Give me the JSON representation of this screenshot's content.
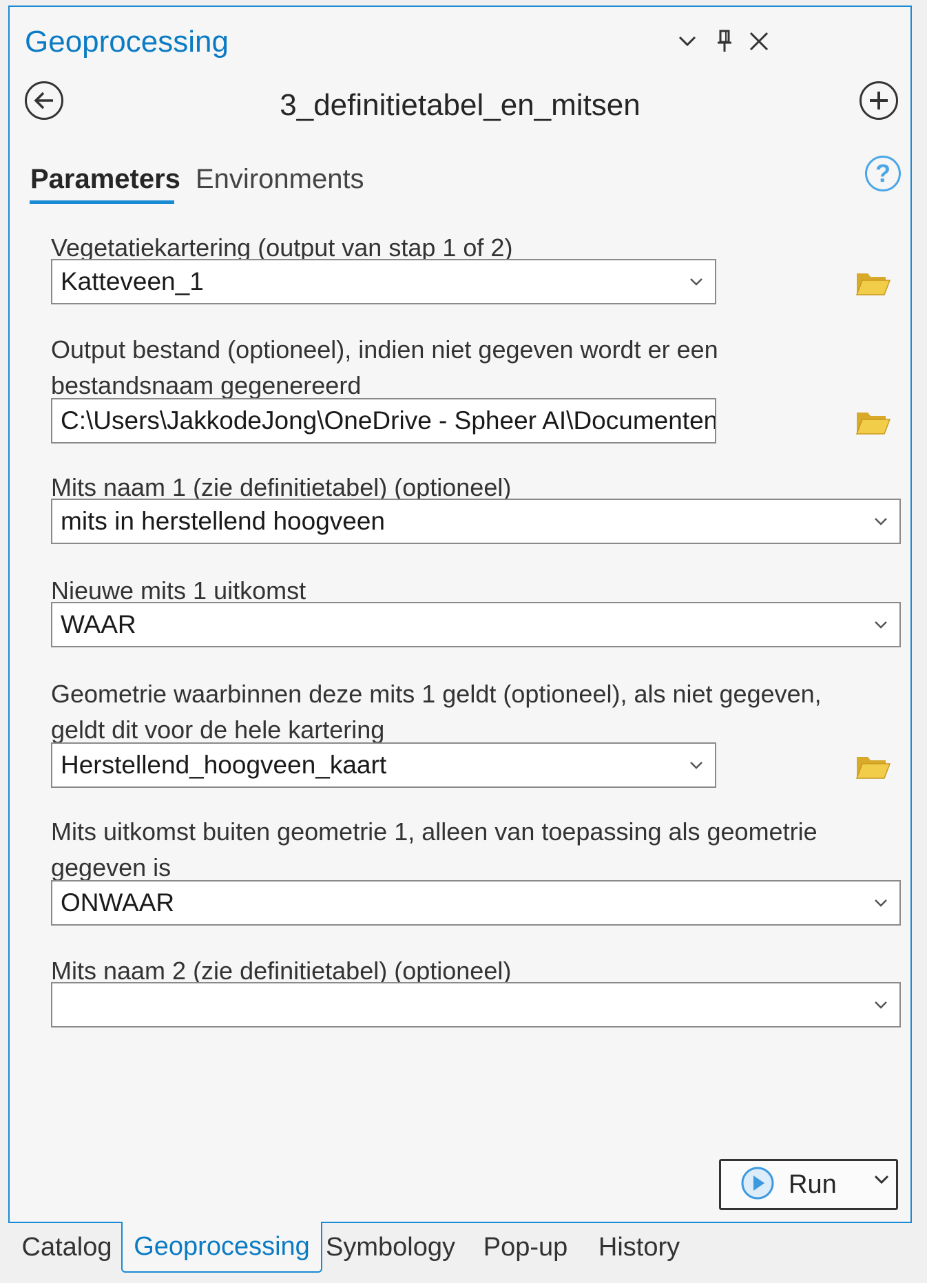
{
  "pane": {
    "title": "Geoprocessing",
    "tool_name": "3_definitietabel_en_mitsen",
    "controls": {
      "collapse_icon": "chevron-down-icon",
      "pin_icon": "pin-icon",
      "close_icon": "close-icon"
    }
  },
  "tabs": {
    "parameters": "Parameters",
    "environments": "Environments",
    "help_icon": "help-icon",
    "help_glyph": "?"
  },
  "params": [
    {
      "label": "Vegetatiekartering (output van stap 1 of 2)",
      "value": "Katteveen_1"
    },
    {
      "label": "Output bestand (optioneel), indien niet gegeven wordt er een bestandsnaam gegenereerd",
      "value": "C:\\Users\\JakkodeJong\\OneDrive - Spheer AI\\Documenten\\ArcGIS\\Pro"
    },
    {
      "label": "Mits naam 1 (zie definitietabel) (optioneel)",
      "value": "mits in herstellend hoogveen"
    },
    {
      "label": "Nieuwe mits 1 uitkomst",
      "value": "WAAR"
    },
    {
      "label": "Geometrie waarbinnen deze mits 1 geldt (optioneel), als niet gegeven, geldt dit voor de hele kartering",
      "value": "Herstellend_hoogveen_kaart"
    },
    {
      "label": "Mits uitkomst buiten geometrie 1, alleen van toepassing als geometrie gegeven is",
      "value": "ONWAAR"
    },
    {
      "label": "Mits naam 2 (zie definitietabel) (optioneel)",
      "value": ""
    }
  ],
  "run": {
    "label": "Run"
  },
  "bottom_tabs": [
    "Catalog",
    "Geoprocessing",
    "Symbology",
    "Pop-up",
    "History"
  ],
  "colors": {
    "accent": "#1a8ad4",
    "title": "#0b7bc4",
    "folder": "#e8c33a"
  }
}
